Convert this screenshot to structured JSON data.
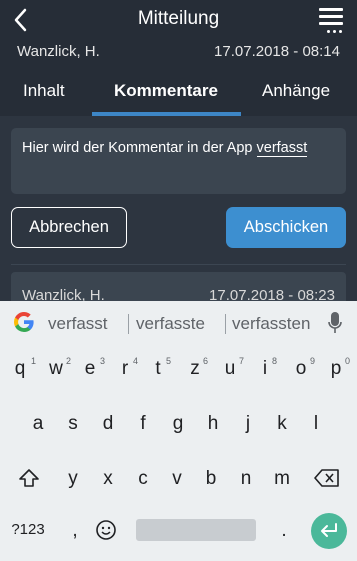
{
  "header": {
    "title": "Mitteilung",
    "back_icon": "chevron-left-icon",
    "menu_icon": "hamburger-menu-icon"
  },
  "message_meta": {
    "author": "Wanzlick, H.",
    "date": "17.07.2018 - 08:14"
  },
  "tabs": [
    {
      "label": "Inhalt",
      "active": false
    },
    {
      "label": "Kommentare",
      "active": true
    },
    {
      "label": "Anhänge",
      "active": false
    }
  ],
  "comment_input": {
    "value_prefix": "Hier wird der Kommentar in der App ",
    "value_underlined": "verfasst"
  },
  "buttons": {
    "cancel": "Abbrechen",
    "send": "Abschicken"
  },
  "previous_comment": {
    "author": "Wanzlick, H.",
    "date": "17.07.2018 - 08:23"
  },
  "keyboard": {
    "suggestions": [
      "verfasst",
      "verfasste",
      "verfassten"
    ],
    "row1": [
      {
        "k": "q",
        "h": "1"
      },
      {
        "k": "w",
        "h": "2"
      },
      {
        "k": "e",
        "h": "3"
      },
      {
        "k": "r",
        "h": "4"
      },
      {
        "k": "t",
        "h": "5"
      },
      {
        "k": "z",
        "h": "6"
      },
      {
        "k": "u",
        "h": "7"
      },
      {
        "k": "i",
        "h": "8"
      },
      {
        "k": "o",
        "h": "9"
      },
      {
        "k": "p",
        "h": "0"
      }
    ],
    "row2": [
      "a",
      "s",
      "d",
      "f",
      "g",
      "h",
      "j",
      "k",
      "l"
    ],
    "row3": [
      "y",
      "x",
      "c",
      "v",
      "b",
      "n",
      "m"
    ],
    "symbols_key": "?123",
    "comma_key": ",",
    "period_key": ".",
    "emoji_icon": "smiley-icon",
    "shift_icon": "shift-arrow-icon",
    "backspace_icon": "backspace-icon",
    "enter_icon": "enter-arrow-icon",
    "mic_icon": "microphone-icon",
    "accent_color": "#3d8fd0",
    "enter_color": "#4bb89a"
  }
}
